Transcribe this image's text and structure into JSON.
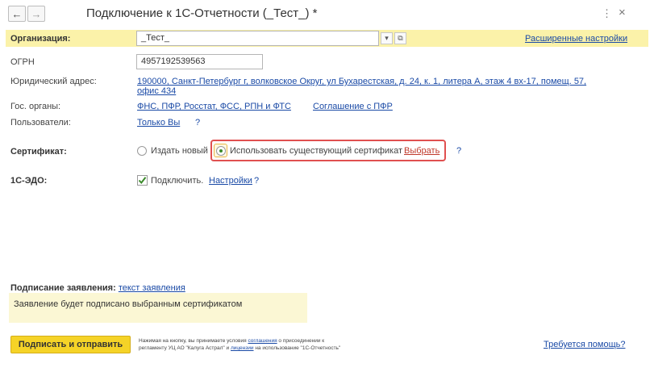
{
  "window": {
    "title": "Подключение к 1С-Отчетности (_Тест_) *",
    "back_icon": "←",
    "forward_icon": "→",
    "menu_icon": "⋮",
    "close_icon": "×"
  },
  "organization": {
    "label": "Организация:",
    "value": "_Тест_",
    "dropdown_icon": "▾",
    "open_icon": "⧉",
    "advanced_link": "Расширенные настройки"
  },
  "ogrn": {
    "label": "ОГРН",
    "value": "4957192539563"
  },
  "address": {
    "label": "Юридический адрес:",
    "line1": "190000, Санкт-Петербург г, волковское Округ, ул Бухарестская, д. 24, к. 1, литера А, этаж 4 вх-17, помещ. 57,",
    "line2": "офис 434"
  },
  "gov_bodies": {
    "label": "Гос. органы:",
    "value": "ФНС, ПФР, Росстат, ФСС, РПН и ФТС",
    "agreement_link": "Соглашение с ПФР"
  },
  "users": {
    "label": "Пользователи:",
    "value": "Только Вы",
    "help": "?"
  },
  "certificate": {
    "label": "Сертификат:",
    "option_new": "Издать новый",
    "option_existing": "Использовать существующий сертификат",
    "select_link": "Выбрать",
    "help": "?",
    "selected": "existing"
  },
  "edo": {
    "label": "1С-ЭДО:",
    "checkbox_label": "Подключить.",
    "checked": true,
    "settings_link": "Настройки",
    "help": "?"
  },
  "signing": {
    "label": "Подписание заявления:",
    "link": "текст заявления",
    "note": "Заявление будет подписано выбранным сертификатом"
  },
  "footer": {
    "submit_button": "Подписать и отправить",
    "terms_part1": "Нажимая на кнопку, вы принимаете условия ",
    "terms_link1": "соглашения",
    "terms_part2": " о присоединении к",
    "terms_part3": "регламенту УЦ АО \"Калуга Астрал\" и ",
    "terms_link2": "лицензии",
    "terms_part4": " на использование \"1С-Отчетность\"",
    "help_link": "Требуется помощь?"
  },
  "colors": {
    "accent_yellow": "#f5d327",
    "band_yellow": "#fbf2a9",
    "link_blue": "#1a4aa6",
    "select_red": "#c0392b",
    "highlight_red": "#e05050",
    "check_green": "#3a8a2a"
  }
}
